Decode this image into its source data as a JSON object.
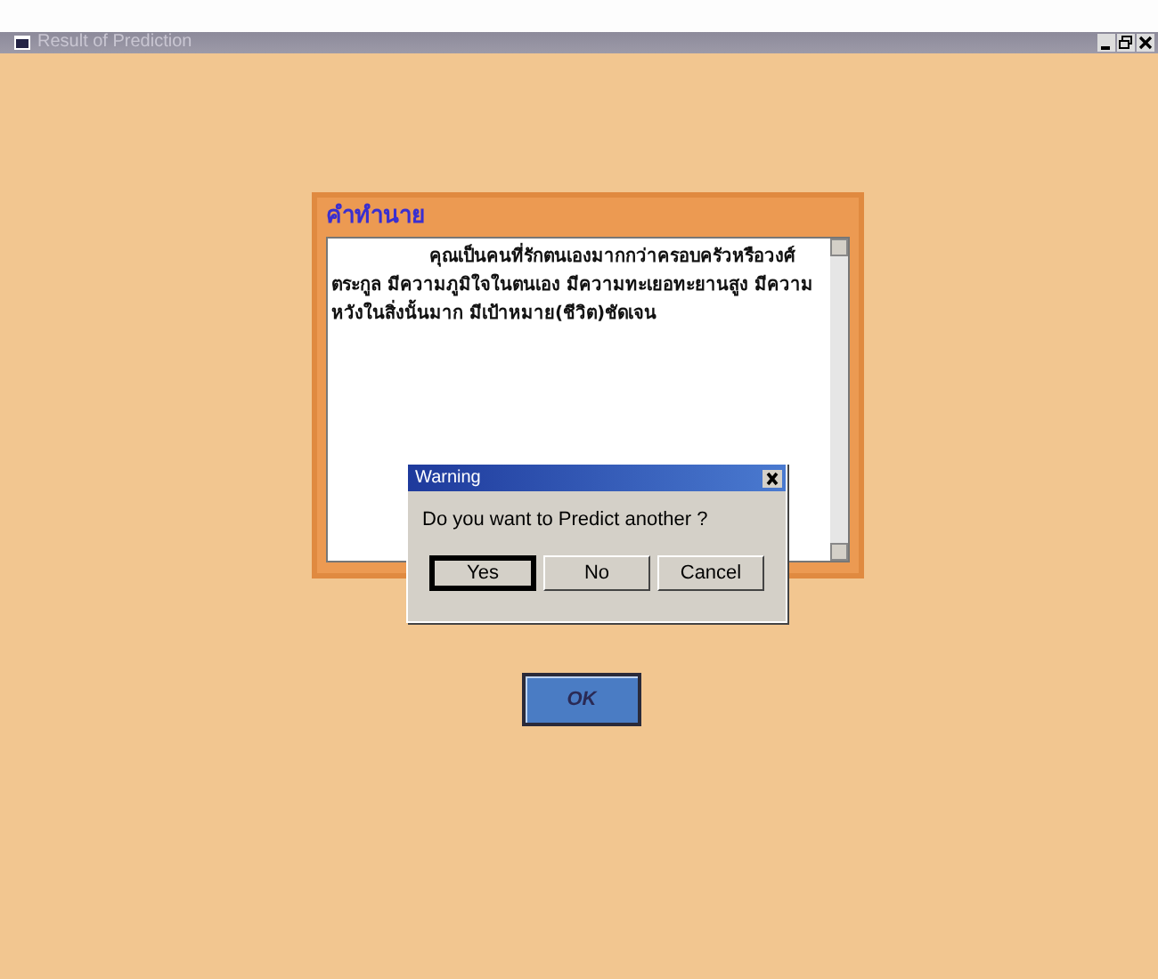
{
  "window": {
    "title": "Result of Prediction"
  },
  "panel": {
    "heading": "คำทำนาย",
    "text": "คุณเป็นคนที่รักตนเองมากกว่าครอบครัวหรือวงศ์ตระกูล มีความภูมิใจในตนเอง  มีความทะเยอทะยานสูง  มีความหวังในสิ่งนั้นมาก  มีเป้าหมาย(ชีวิต)ชัดเจน"
  },
  "ok_button": {
    "label": "OK"
  },
  "dialog": {
    "title": "Warning",
    "message": "Do you want to Predict another ?",
    "buttons": [
      {
        "label": "Yes",
        "selected": true
      },
      {
        "label": "No",
        "selected": false
      },
      {
        "label": "Cancel",
        "selected": false
      }
    ]
  }
}
